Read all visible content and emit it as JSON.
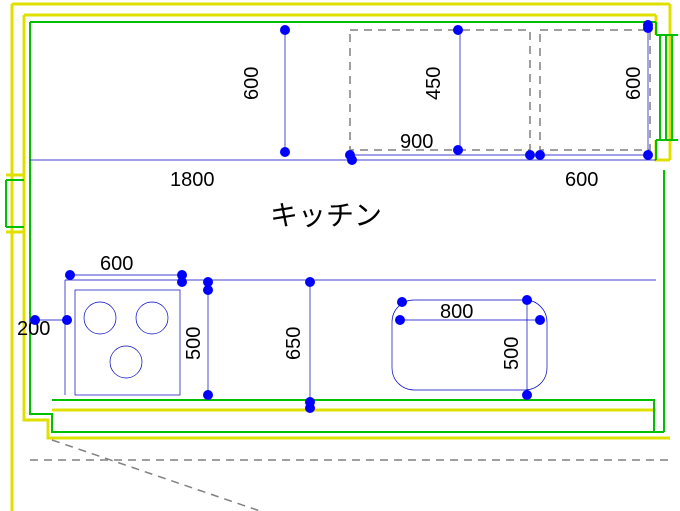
{
  "room_name": "キッチン",
  "dims": {
    "d1800": "1800",
    "d900": "900",
    "d600a": "600",
    "d600b": "600",
    "d600c": "600",
    "d600d": "600",
    "d450": "450",
    "d800": "800",
    "d500a": "500",
    "d500b": "500",
    "d650": "650",
    "d200": "200"
  }
}
